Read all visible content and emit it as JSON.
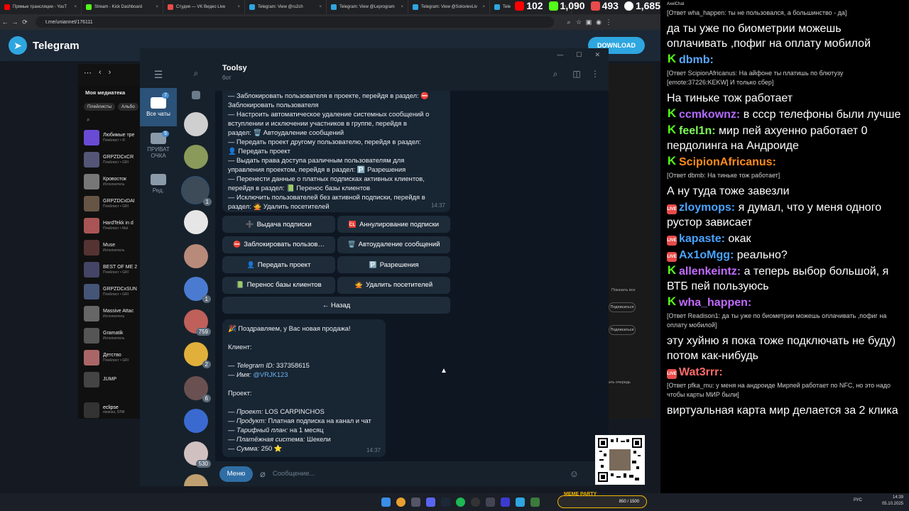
{
  "browser": {
    "tabs": [
      {
        "title": "Прямые трансляции - YouT",
        "color": "#ff0000"
      },
      {
        "title": "Stream - Kick Dashboard",
        "color": "#53fc18"
      },
      {
        "title": "Студия — VK Видео Live",
        "color": "#e84b4b"
      },
      {
        "title": "Telegram: View @ru2ch",
        "color": "#2ea6e0"
      },
      {
        "title": "Telegram: View @Leprogram",
        "color": "#2ea6e0"
      },
      {
        "title": "Telegram: View @SolovievLiv",
        "color": "#2ea6e0"
      },
      {
        "title": "Tele",
        "color": "#2ea6e0"
      }
    ],
    "url": "t.me/uniannet/176111"
  },
  "stream_stats": {
    "youtube": "102",
    "kick": "1,090",
    "vk": "493",
    "total": "1,685"
  },
  "tg_web": {
    "brand": "Telegram",
    "download": "DOWNLOAD"
  },
  "music": {
    "header": "Моя медиатека",
    "filters": [
      "Плейлисты",
      "Альбо"
    ],
    "items": [
      {
        "title": "Любимые тре",
        "sub": "Плейлист • Я"
      },
      {
        "title": "GRPZDCxCR",
        "sub": "Плейлист • GRI"
      },
      {
        "title": "Кровосток",
        "sub": "Исполнитель"
      },
      {
        "title": "GRPZDCxDAI",
        "sub": "Плейлист • GRI"
      },
      {
        "title": "HardTekk in d",
        "sub": "Плейлист • Mal"
      },
      {
        "title": "Muse",
        "sub": "Исполнитель"
      },
      {
        "title": "BEST OF ME 2",
        "sub": "Плейлист • GRI"
      },
      {
        "title": "GRPZDCxSUN",
        "sub": "Плейлист • GRI"
      },
      {
        "title": "Massive Attac",
        "sub": "Исполнитель"
      },
      {
        "title": "Gramatik",
        "sub": "Исполнитель"
      },
      {
        "title": "Детство",
        "sub": "Плейлист • GRI"
      },
      {
        "title": "JUMP",
        "sub": ""
      }
    ],
    "now_playing": {
      "title": "eclipse",
      "artist": "rivoices, STM"
    }
  },
  "tg_desktop": {
    "folders": [
      {
        "label": "Все чаты",
        "badge": "7"
      },
      {
        "label": "ПРИВАТ ОЧКА",
        "badge": "5"
      },
      {
        "label": "Ред.",
        "badge": ""
      }
    ],
    "chat_badges": [
      "1",
      "1",
      "759",
      "2",
      "6",
      "530"
    ],
    "chat": {
      "title": "Toolsy",
      "subtitle": "бот"
    },
    "msg1": {
      "lines": [
        "— Заблокировать пользователя в проекте, перейдя в раздел: ⛔",
        "Заблокировать пользователя",
        "— Настроить автоматическое удаление системных сообщений о",
        "вступлении и исключении участников в группе, перейдя в",
        "раздел: 🗑️ Автоудаление сообщений",
        "— Передать проект другому пользователю, перейдя в раздел:",
        "👤 Передать проект",
        "— Выдать права доступа различным пользователям для",
        "управления проектом, перейдя в раздел: 🅿️ Разрешения",
        "— Перенести данные о платных подписках активных клиентов,",
        "перейдя в раздел: 📗 Перенос базы клиентов",
        "— Исключить пользователей без активной подписки, перейдя в",
        "раздел: 🙅 Удалить посетителей"
      ],
      "time": "14:37"
    },
    "keyboard": [
      {
        "label": "Выдача подписки",
        "emoji": "➕"
      },
      {
        "label": "Аннулирование подписки",
        "emoji": "🆑"
      },
      {
        "label": "Заблокировать пользов…",
        "emoji": "⛔"
      },
      {
        "label": "Автоудаление сообщений",
        "emoji": "🗑️"
      },
      {
        "label": "Передать проект",
        "emoji": "👤"
      },
      {
        "label": "Разрешения",
        "emoji": "🅿️"
      },
      {
        "label": "Перенос базы клиентов",
        "emoji": "📗"
      },
      {
        "label": "Удалить посетителей",
        "emoji": "🙅"
      },
      {
        "label": "← Назад",
        "emoji": ""
      }
    ],
    "msg2": {
      "greeting": "🎉 Поздравляем, у Вас новая продажа!",
      "client_header": "Клиент:",
      "tg_id_label": "— Telegram ID:",
      "tg_id": "337358615",
      "name_label": "— Имя:",
      "name": "@VRJK123",
      "project_header": "Проект:",
      "project_label": "— Проект:",
      "project": "LOS CARPINCHOS",
      "product_label": "— Продукт:",
      "product": "Платная подписка на канал и чат",
      "plan_label": "— Тарифный план:",
      "plan": "на 1 месяц",
      "payment_label": "— Платёжная система:",
      "payment": "Шекели",
      "sum_label": "— Сумма:",
      "sum": "250 ⭐",
      "time": "14:37"
    },
    "input": {
      "menu": "Меню",
      "placeholder": "Сообщение..."
    }
  },
  "video_panel": {
    "show_all": "Показать все",
    "subscribe": "Подписаться",
    "queue": "ать очередь"
  },
  "chat_overlay": {
    "title": "AxelChat",
    "messages": [
      {
        "reply": "[Ответ wha_happen: ты не пользовался, а большинство - да]",
        "platform": "",
        "nick": "",
        "color": "",
        "text": "да ты уже по биометрии можешь оплачивать ,пофиг на оплату мобилой"
      },
      {
        "reply": "",
        "platform": "kick",
        "nick": "dbmb:",
        "color": "#5aa9ff",
        "text": ""
      },
      {
        "reply": "[Ответ ScipionAfricanus: На айфоне ты платишь по блютузу [emote:37226:KEKW] И только сбер]",
        "platform": "",
        "nick": "",
        "color": "",
        "text": "На тиньке тож работает"
      },
      {
        "reply": "",
        "platform": "kick",
        "nick": "ccmkownz:",
        "color": "#b36bff",
        "text": "в ссср телефоны были лучше"
      },
      {
        "reply": "",
        "platform": "kick",
        "nick": "feel1n:",
        "color": "#7fff5a",
        "text": "мир пей ахуенно работает 0 пердолинга на Андроиде"
      },
      {
        "reply": "",
        "platform": "kick",
        "nick": "ScipionAfricanus:",
        "color": "#ff8c1a",
        "text": ""
      },
      {
        "reply": "[Ответ dbmb: На тиньке тож работает]",
        "platform": "",
        "nick": "",
        "color": "",
        "text": "А ну туда тоже завезли"
      },
      {
        "reply": "",
        "platform": "vk",
        "nick": "zloymops:",
        "color": "#4aa3ff",
        "text": "я думал, что у меня одного рустор зависает"
      },
      {
        "reply": "",
        "platform": "vk",
        "nick": "kapaste:",
        "color": "#4aa3ff",
        "text": "окак"
      },
      {
        "reply": "",
        "platform": "vk",
        "nick": "Ax1oMgg:",
        "color": "#4aa3ff",
        "text": "реально?"
      },
      {
        "reply": "",
        "platform": "kick",
        "nick": "allenkeintz:",
        "color": "#c26bff",
        "text": "а теперь выбор большой, я ВТБ пей пользуюсь"
      },
      {
        "reply": "",
        "platform": "kick",
        "nick": "wha_happen:",
        "color": "#c26bff",
        "text": ""
      },
      {
        "reply": "[Ответ Readison1: да ты уже по биометрии можешь оплачивать ,пофиг на оплату мобилой]",
        "platform": "",
        "nick": "",
        "color": "",
        "text": "эту хуйню я пока тоже подключать не буду) потом как-нибудь"
      },
      {
        "reply": "",
        "platform": "vk",
        "nick": "Wat3rrr:",
        "color": "#ff6b6b",
        "text": ""
      },
      {
        "reply": "[Ответ pfka_mu: у меня на андроиде Мирпей работает по NFC, но это надо чтобы карты МИР были]",
        "platform": "",
        "nick": "",
        "color": "",
        "text": "виртуальная карта мир делается за 2 клика"
      }
    ]
  },
  "taskbar": {
    "meme_party": "МЕМЕ PARTY",
    "meme_progress": "850 / 1500",
    "lang": "РУС",
    "time": "14:39",
    "date": "05.10.2025"
  },
  "colors": {
    "tg_accent": "#2ea6e0",
    "tg_bg": "#0e1621",
    "tg_panel": "#17212b",
    "bubble": "#182533",
    "link": "#6ab2f2",
    "kick": "#53fc18",
    "vk": "#e84b4b"
  }
}
